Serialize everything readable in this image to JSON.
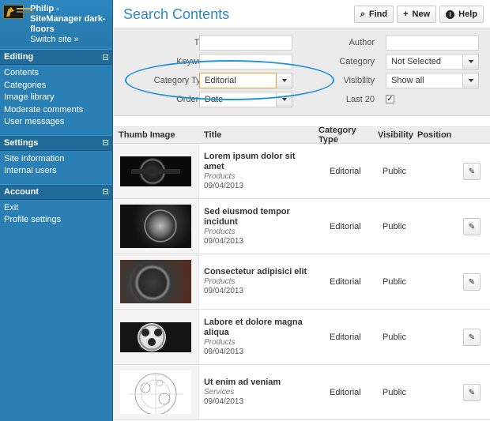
{
  "sidebar": {
    "site_name": "Philip - SiteManager dark-floors",
    "switch_site": "Switch site »",
    "sections": [
      {
        "title": "Editing",
        "items": [
          "Contents",
          "Categories",
          "Image library",
          "Moderate comments",
          "User messages"
        ]
      },
      {
        "title": "Settings",
        "items": [
          "Site information",
          "Internal users"
        ]
      },
      {
        "title": "Account",
        "items": [
          "Exit",
          "Profile settings"
        ]
      }
    ]
  },
  "header": {
    "title": "Search Contents",
    "buttons": {
      "find": "Find",
      "new": "New",
      "help": "Help"
    }
  },
  "filters": {
    "title_label": "Title",
    "keyword_label": "Keyword",
    "category_type_label": "Category Type",
    "category_type_value": "Editorial",
    "order_by_label": "Order by",
    "order_by_value": "Date",
    "author_label": "Author",
    "category_label": "Category",
    "category_value": "Not Selected",
    "visibility_label": "Visibility",
    "visibility_value": "Show all",
    "last20_label": "Last 20",
    "last20_checked": true
  },
  "table": {
    "columns": [
      "Thumb Image",
      "Title",
      "Category Type",
      "Visibility",
      "Position"
    ],
    "rows": [
      {
        "title": "Lorem ipsum dolor sit amet",
        "section": "Products",
        "date": "09/04/2013",
        "category_type": "Editorial",
        "visibility": "Public",
        "thumb": "black watch"
      },
      {
        "title": "Sed eiusmod tempor incidunt",
        "section": "Products",
        "date": "09/04/2013",
        "category_type": "Editorial",
        "visibility": "Public",
        "thumb": "skeleton watch"
      },
      {
        "title": "Consectetur adipisici elit",
        "section": "Products",
        "date": "09/04/2013",
        "category_type": "Editorial",
        "visibility": "Public",
        "thumb": "chronograph watch"
      },
      {
        "title": "Labore et dolore magna aliqua",
        "section": "Products",
        "date": "09/04/2013",
        "category_type": "Editorial",
        "visibility": "Public",
        "thumb": "white dial watch"
      },
      {
        "title": "Ut enim ad veniam",
        "section": "Services",
        "date": "09/04/2013",
        "category_type": "Editorial",
        "visibility": "Public",
        "thumb": "technical drawing"
      }
    ]
  },
  "colors": {
    "sidebar": "#2a7fb4",
    "title": "#2f87c4",
    "highlight_ellipse": "#2394d8"
  }
}
